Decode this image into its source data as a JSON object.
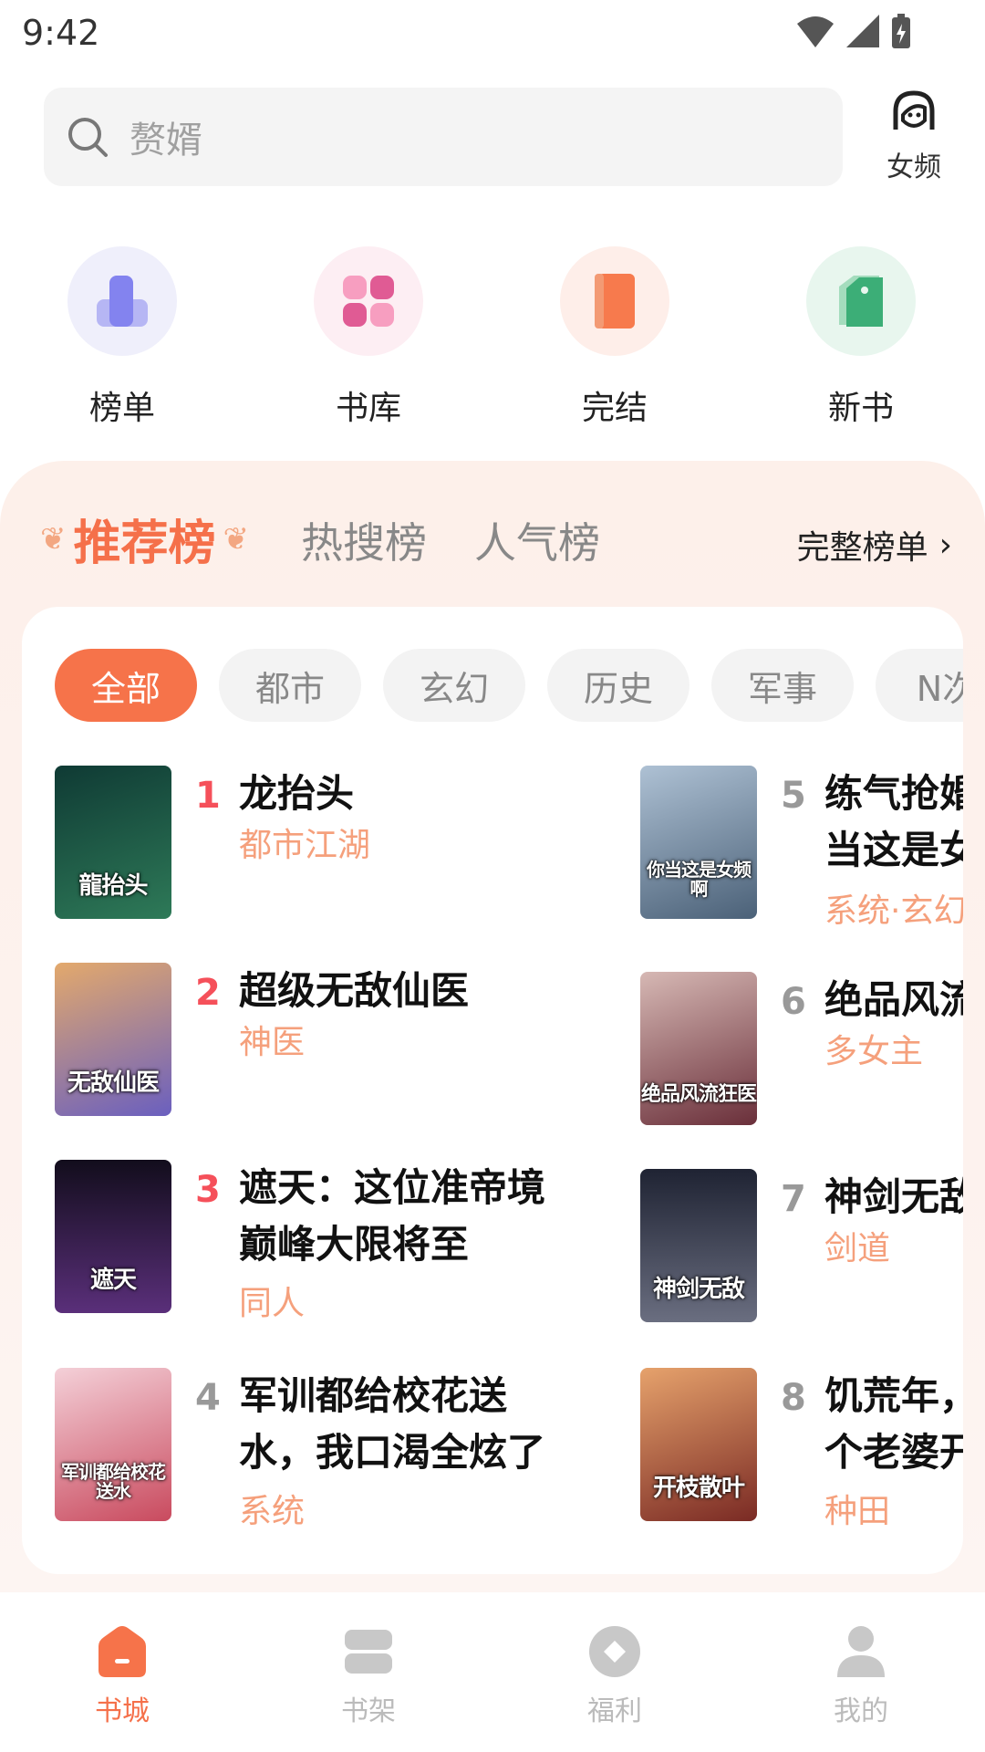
{
  "status_bar": {
    "time": "9:42"
  },
  "search": {
    "placeholder": "赘婿"
  },
  "female_channel": {
    "label": "女频"
  },
  "categories": [
    {
      "label": "榜单",
      "color": "#8e8ef5",
      "bg": "#efeffb"
    },
    {
      "label": "书库",
      "color": "#e55e95",
      "bg": "#fdeef3"
    },
    {
      "label": "完结",
      "color": "#f77a4d",
      "bg": "#feeee9"
    },
    {
      "label": "新书",
      "color": "#3cae77",
      "bg": "#e8f6ee"
    }
  ],
  "rank_tabs": {
    "active": "推荐榜",
    "tab2": "热搜榜",
    "tab3": "人气榜",
    "full_label": "完整榜单"
  },
  "chips": [
    "全部",
    "都市",
    "玄幻",
    "历史",
    "军事",
    "N次"
  ],
  "books": [
    {
      "rank": "1",
      "title_lines": [
        "龙抬头"
      ],
      "tag": "都市江湖",
      "cover_text": "龍抬头",
      "cover_colors": [
        "#0f3a34",
        "#2e7a58"
      ]
    },
    {
      "rank": "2",
      "title_lines": [
        "超级无敌仙医"
      ],
      "tag": "神医",
      "cover_text": "无敌仙医",
      "cover_colors": [
        "#e3a96c",
        "#6a5fbf"
      ]
    },
    {
      "rank": "3",
      "title_lines": [
        "遮天：这位准帝境",
        "巅峰大限将至"
      ],
      "tag": "同人",
      "cover_text": "遮天",
      "cover_colors": [
        "#120d1c",
        "#5a2f7a"
      ]
    },
    {
      "rank": "4",
      "title_lines": [
        "军训都给校花送",
        "水，我口渴全炫了"
      ],
      "tag": "系统",
      "cover_text": "军训都给校花送水",
      "cover_colors": [
        "#f4d0d8",
        "#c94a5e"
      ]
    },
    {
      "rank": "5",
      "title_lines": [
        "练气抢婚",
        "当这是女"
      ],
      "tag": "系统·玄幻",
      "cover_text": "你当这是女频啊",
      "cover_colors": [
        "#aec1d4",
        "#4b6178"
      ]
    },
    {
      "rank": "6",
      "title_lines": [
        "绝品风流"
      ],
      "tag": "多女主",
      "cover_text": "绝品风流狂医",
      "cover_colors": [
        "#d6b8b4",
        "#6a2f3a"
      ]
    },
    {
      "rank": "7",
      "title_lines": [
        "神剑无敌"
      ],
      "tag": "剑道",
      "cover_text": "神剑无敌",
      "cover_colors": [
        "#1f2333",
        "#6a6e80"
      ]
    },
    {
      "rank": "8",
      "title_lines": [
        "饥荒年，",
        "个老婆开"
      ],
      "tag": "种田",
      "cover_text": "开枝散叶",
      "cover_colors": [
        "#e6a26c",
        "#7a2a24"
      ]
    }
  ],
  "bottom_nav": [
    {
      "label": "书城",
      "active": true
    },
    {
      "label": "书架",
      "active": false
    },
    {
      "label": "福利",
      "active": false
    },
    {
      "label": "我的",
      "active": false
    }
  ],
  "colors": {
    "accent": "#f5704a",
    "tag": "#f5a07c",
    "rank_top": "#f5505a"
  }
}
